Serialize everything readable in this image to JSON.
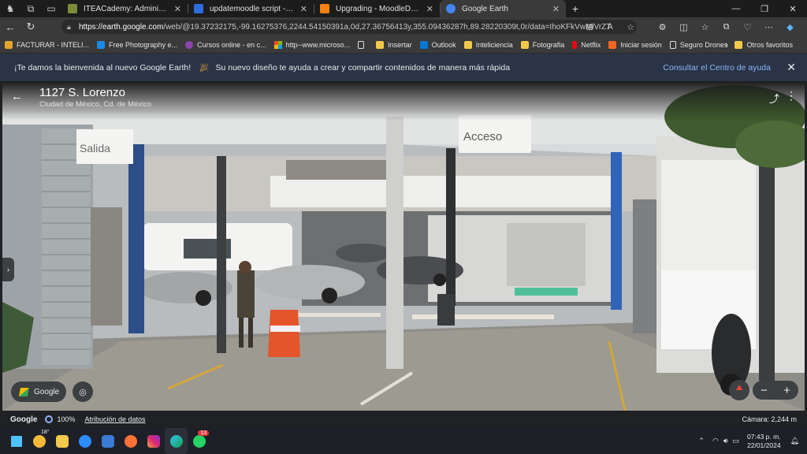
{
  "browser": {
    "tabs": [
      {
        "title": "ITEACademy: Administración: Se",
        "color": "#7a8c3a"
      },
      {
        "title": "updatemoodle script - Búsqueda",
        "color": "#2d6cdf"
      },
      {
        "title": "Upgrading - MoodleDocs",
        "color": "#f98012"
      },
      {
        "title": "Google Earth",
        "color": "#4285f4"
      }
    ],
    "new_tab": "+",
    "url_domain": "https://earth.google.com",
    "url_path": "/web/@19.37232175,-99.16275376,2244.54150391a,0d,27.36756413y,355.09436287h,89.28220309t,0r/data=IhoKFkVwMlVrZT",
    "bookmarks": [
      {
        "label": "FACTURAR - INTELI...",
        "color": "#e3a32b"
      },
      {
        "label": "Free Photography e...",
        "color": "#1e88e5"
      },
      {
        "label": "Cursos online - en c...",
        "color": "#8e44ad"
      },
      {
        "label": "http--www.microso...",
        "color": "#f25022"
      },
      {
        "label": "",
        "color": "#dddddd"
      },
      {
        "label": "Insertar",
        "color": "#f2c94c"
      },
      {
        "label": "Outlook",
        "color": "#0078d4"
      },
      {
        "label": "Inteliciencia",
        "color": "#f2c94c"
      },
      {
        "label": "Fotografia",
        "color": "#f2c94c"
      },
      {
        "label": "Netflix",
        "color": "#e50914"
      },
      {
        "label": "Iniciar sesión",
        "color": "#f26522"
      },
      {
        "label": "Seguro Drones",
        "color": "#dddddd"
      }
    ],
    "other_favorites": "Otros favoritos"
  },
  "banner": {
    "welcome": "¡Te damos la bienvenida al nuevo Google Earth!",
    "message": "Su nuevo diseño te ayuda a crear y compartir contenidos de manera más rápida",
    "help_link": "Consultar el Centro de ayuda"
  },
  "streetview": {
    "title": "1127 S. Lorenzo",
    "subtitle": "Ciudad de México, Cd. de México",
    "sign_exit": "Salida",
    "sign_entry": "Acceso",
    "google_button": "Google"
  },
  "status": {
    "logo": "Google",
    "zoom_pct": "100%",
    "attribution": "Atribución de datos",
    "camera": "Cámara: 2,244 m"
  },
  "taskbar": {
    "temperature": "18°",
    "whatsapp_badge": "13",
    "time": "07:43 p. m.",
    "date": "22/01/2024"
  }
}
